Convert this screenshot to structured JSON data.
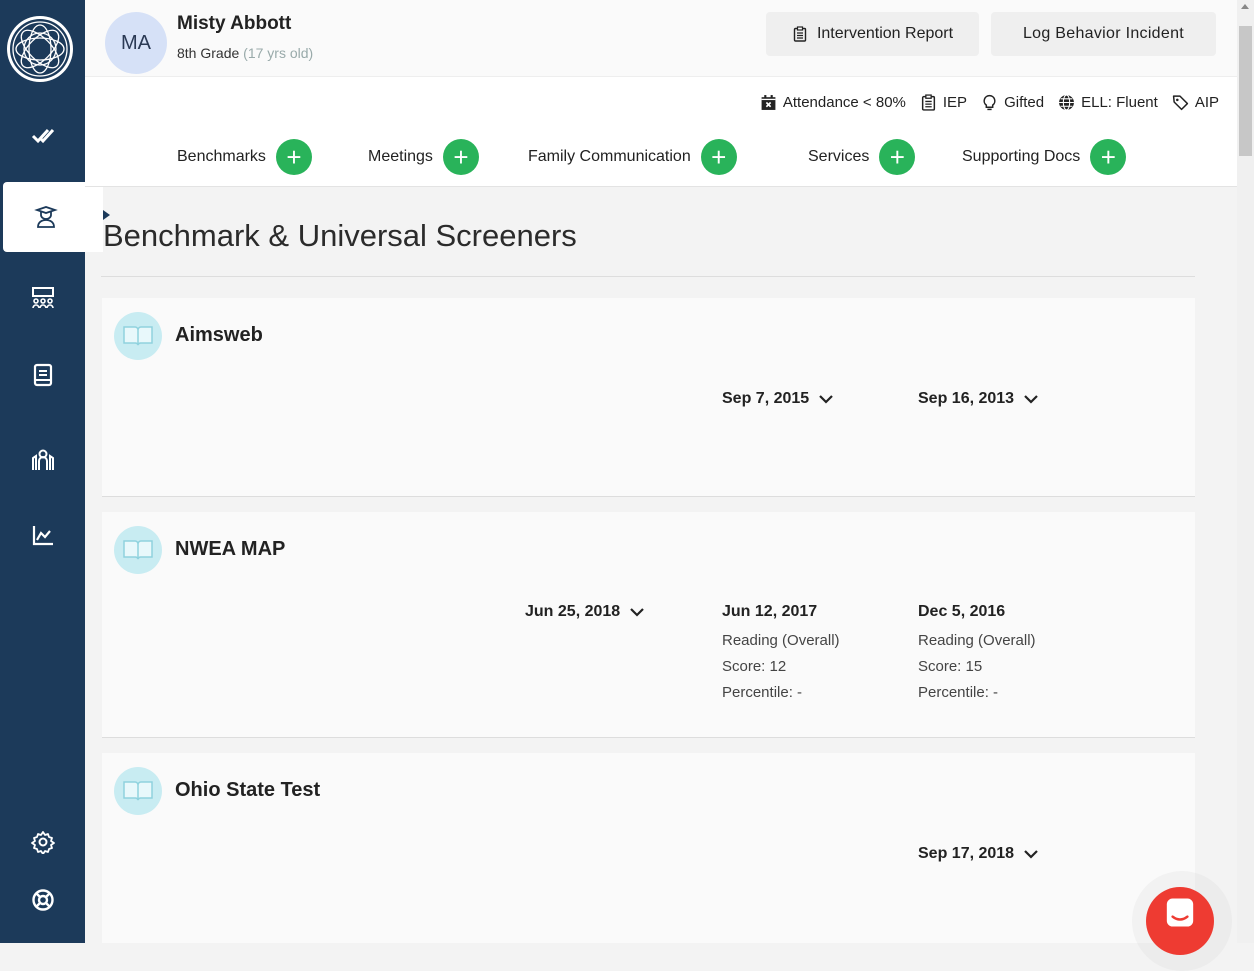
{
  "student": {
    "initials": "MA",
    "name": "Misty Abbott",
    "grade": "8th Grade",
    "age": "(17 yrs old)"
  },
  "header_buttons": {
    "report": "Intervention Report",
    "incident": "Log Behavior Incident"
  },
  "tags": [
    {
      "label": "Attendance < 80%",
      "icon": "calendar-x-icon"
    },
    {
      "label": "IEP",
      "icon": "clipboard-icon"
    },
    {
      "label": "Gifted",
      "icon": "lightbulb-icon"
    },
    {
      "label": "ELL: Fluent",
      "icon": "globe-icon"
    },
    {
      "label": "AIP",
      "icon": "tag-icon"
    }
  ],
  "add_sections": [
    {
      "label": "Benchmarks"
    },
    {
      "label": "Meetings"
    },
    {
      "label": "Family Communication"
    },
    {
      "label": "Services"
    },
    {
      "label": "Supporting Docs"
    }
  ],
  "page_title": "Benchmark & Universal Screeners",
  "screeners": [
    {
      "name": "Aimsweb",
      "dates": [
        {
          "date": "Sep 7, 2015",
          "expandable": true
        },
        {
          "date": "Sep 16, 2013",
          "expandable": true
        }
      ]
    },
    {
      "name": "NWEA MAP",
      "dates": [
        {
          "date": "Jun 25, 2018",
          "expandable": true
        },
        {
          "date": "Jun 12, 2017",
          "expandable": false,
          "subject": "Reading (Overall)",
          "score": "Score: 12",
          "percentile": "Percentile: -"
        },
        {
          "date": "Dec 5, 2016",
          "expandable": false,
          "subject": "Reading (Overall)",
          "score": "Score: 15",
          "percentile": "Percentile: -"
        }
      ]
    },
    {
      "name": "Ohio State Test",
      "dates": [
        {
          "date": "Sep 17, 2018",
          "expandable": true
        }
      ]
    }
  ],
  "sidebar": {
    "items": [
      "check-icon",
      "student-icon",
      "classroom-icon",
      "book-icon",
      "school-icon",
      "chart-icon",
      "settings-icon",
      "help-icon"
    ]
  },
  "colors": {
    "sidebar": "#1c3a5a",
    "add_button": "#29b35a",
    "chat": "#ee3b32",
    "icon_bg": "#c8ecf2"
  }
}
